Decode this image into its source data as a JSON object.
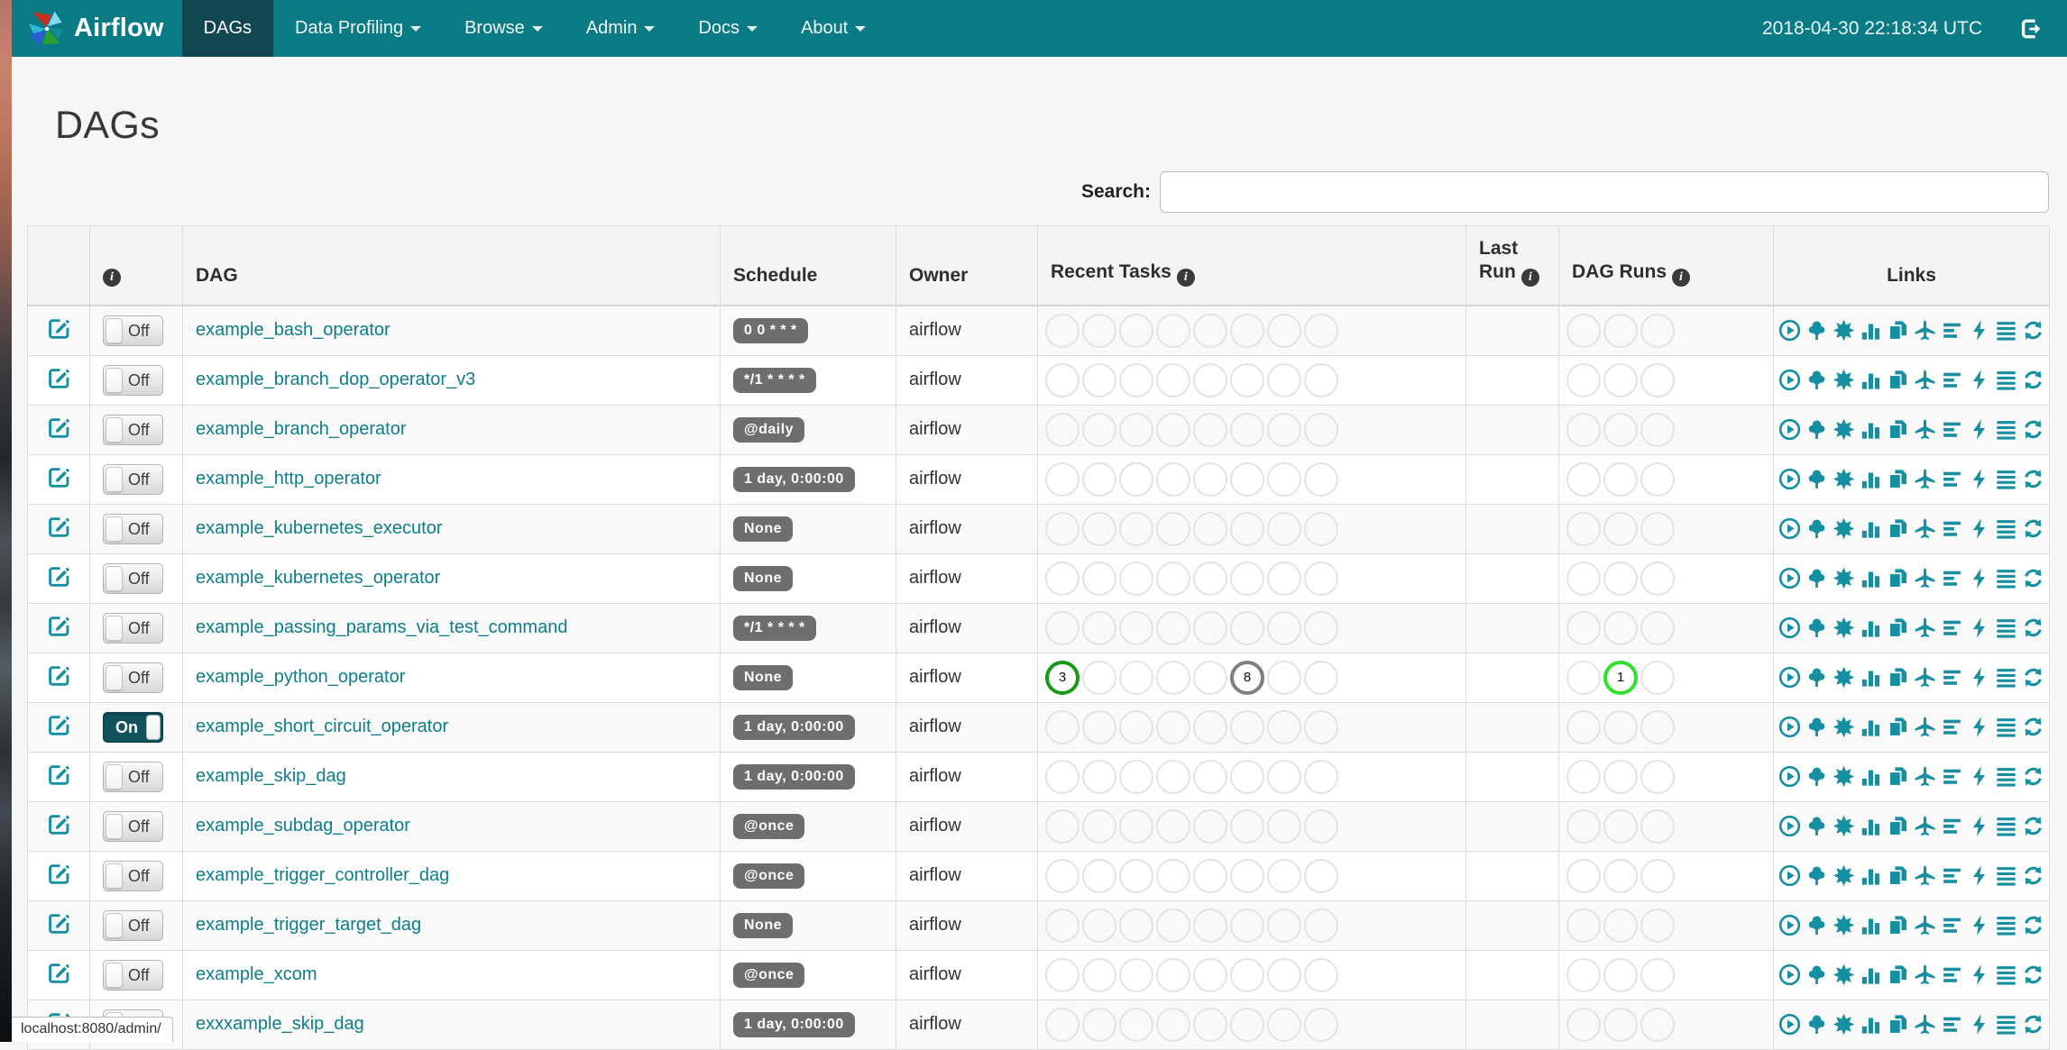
{
  "colors": {
    "navbar_bg": "#0a7b84",
    "navbar_active_bg": "#104750",
    "link_teal": "#0d7e8a",
    "icon_teal": "#1690a1",
    "badge_gray": "#6e6e6e",
    "success_green": "#189a18",
    "queued_gray": "#808080",
    "running_lime": "#2fe02f"
  },
  "icons": {
    "info_glyph": "i"
  },
  "navbar": {
    "brand": "Airflow",
    "clock": "2018-04-30 22:18:34 UTC",
    "items": [
      {
        "label": "DAGs",
        "active": true,
        "dropdown": false
      },
      {
        "label": "Data Profiling",
        "active": false,
        "dropdown": true
      },
      {
        "label": "Browse",
        "active": false,
        "dropdown": true
      },
      {
        "label": "Admin",
        "active": false,
        "dropdown": true
      },
      {
        "label": "Docs",
        "active": false,
        "dropdown": true
      },
      {
        "label": "About",
        "active": false,
        "dropdown": true
      }
    ]
  },
  "page": {
    "title": "DAGs",
    "search_label": "Search:",
    "search_value": "",
    "status_bar": "localhost:8080/admin/"
  },
  "table": {
    "headers": {
      "dag": "DAG",
      "schedule": "Schedule",
      "owner": "Owner",
      "recent_tasks": "Recent Tasks",
      "last_run_line1": "Last",
      "last_run_line2": "Run",
      "dag_runs": "DAG Runs",
      "links": "Links"
    },
    "toggle": {
      "on": "On",
      "off": "Off"
    },
    "recent_task_slots": 8,
    "dag_run_slots": 3,
    "links_icons": [
      "trigger-dag",
      "tree-view",
      "graph-view",
      "task-duration",
      "task-tries",
      "landing-times",
      "gantt-view",
      "code-view",
      "logs",
      "refresh"
    ]
  },
  "dags": [
    {
      "name": "example_bash_operator",
      "enabled": false,
      "schedule": "0 0 * * *",
      "owner": "airflow",
      "task_markers": [],
      "run_markers": []
    },
    {
      "name": "example_branch_dop_operator_v3",
      "enabled": false,
      "schedule": "*/1 * * * *",
      "owner": "airflow",
      "task_markers": [],
      "run_markers": []
    },
    {
      "name": "example_branch_operator",
      "enabled": false,
      "schedule": "@daily",
      "owner": "airflow",
      "task_markers": [],
      "run_markers": []
    },
    {
      "name": "example_http_operator",
      "enabled": false,
      "schedule": "1 day, 0:00:00",
      "owner": "airflow",
      "task_markers": [],
      "run_markers": []
    },
    {
      "name": "example_kubernetes_executor",
      "enabled": false,
      "schedule": "None",
      "owner": "airflow",
      "task_markers": [],
      "run_markers": []
    },
    {
      "name": "example_kubernetes_operator",
      "enabled": false,
      "schedule": "None",
      "owner": "airflow",
      "task_markers": [],
      "run_markers": []
    },
    {
      "name": "example_passing_params_via_test_command",
      "enabled": false,
      "schedule": "*/1 * * * *",
      "owner": "airflow",
      "task_markers": [],
      "run_markers": []
    },
    {
      "name": "example_python_operator",
      "enabled": false,
      "schedule": "None",
      "owner": "airflow",
      "task_markers": [
        {
          "slot": 0,
          "count": "3",
          "state": "success"
        },
        {
          "slot": 5,
          "count": "8",
          "state": "queued"
        }
      ],
      "run_markers": [
        {
          "slot": 1,
          "count": "1",
          "state": "running"
        }
      ]
    },
    {
      "name": "example_short_circuit_operator",
      "enabled": true,
      "schedule": "1 day, 0:00:00",
      "owner": "airflow",
      "task_markers": [],
      "run_markers": []
    },
    {
      "name": "example_skip_dag",
      "enabled": false,
      "schedule": "1 day, 0:00:00",
      "owner": "airflow",
      "task_markers": [],
      "run_markers": []
    },
    {
      "name": "example_subdag_operator",
      "enabled": false,
      "schedule": "@once",
      "owner": "airflow",
      "task_markers": [],
      "run_markers": []
    },
    {
      "name": "example_trigger_controller_dag",
      "enabled": false,
      "schedule": "@once",
      "owner": "airflow",
      "task_markers": [],
      "run_markers": []
    },
    {
      "name": "example_trigger_target_dag",
      "enabled": false,
      "schedule": "None",
      "owner": "airflow",
      "task_markers": [],
      "run_markers": []
    },
    {
      "name": "example_xcom",
      "enabled": false,
      "schedule": "@once",
      "owner": "airflow",
      "task_markers": [],
      "run_markers": []
    },
    {
      "name": "exxxample_skip_dag",
      "enabled": false,
      "schedule": "1 day, 0:00:00",
      "owner": "airflow",
      "task_markers": [],
      "run_markers": []
    }
  ]
}
